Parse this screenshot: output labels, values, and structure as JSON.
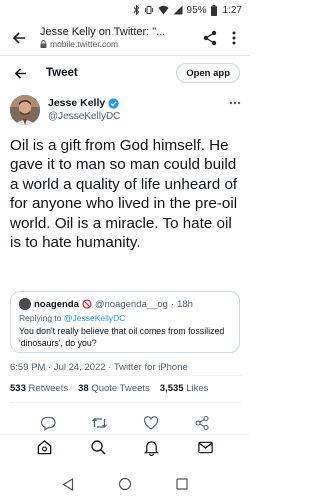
{
  "status_bar": {
    "battery": "95%",
    "time": "1:27"
  },
  "browser": {
    "title": "Jesse Kelly on Twitter: \"...",
    "url": "mobile.twitter.com"
  },
  "header": {
    "title": "Tweet",
    "open_app": "Open app"
  },
  "tweet": {
    "author_name": "Jesse Kelly",
    "author_handle": "@JesseKellyDC",
    "text": "Oil is a gift from God himself. He gave it to man so man could build a world a quality of life unheard of for anyone who lived in the pre-oil world. Oil is a miracle. To hate oil is to hate humanity.",
    "quote": {
      "name": "noagenda",
      "handle": "@noagenda__og",
      "time": "18h",
      "reply_prefix": "Replying to ",
      "reply_to": "@JesseKellyDC",
      "text": "You don't really believe that oil comes from fossilized 'dinosaurs', do you?"
    },
    "meta": "6:59 PM · Jul 24, 2022 · Twitter for iPhone",
    "stats": {
      "retweets": "533",
      "retweets_label": "Retweets",
      "quotes": "38",
      "quotes_label": "Quote Tweets",
      "likes": "3,535",
      "likes_label": "Likes"
    }
  },
  "colors": {
    "accent": "#1d9bf0",
    "text": "#0f1419",
    "muted": "#536471",
    "blocked": "#f4212e"
  }
}
